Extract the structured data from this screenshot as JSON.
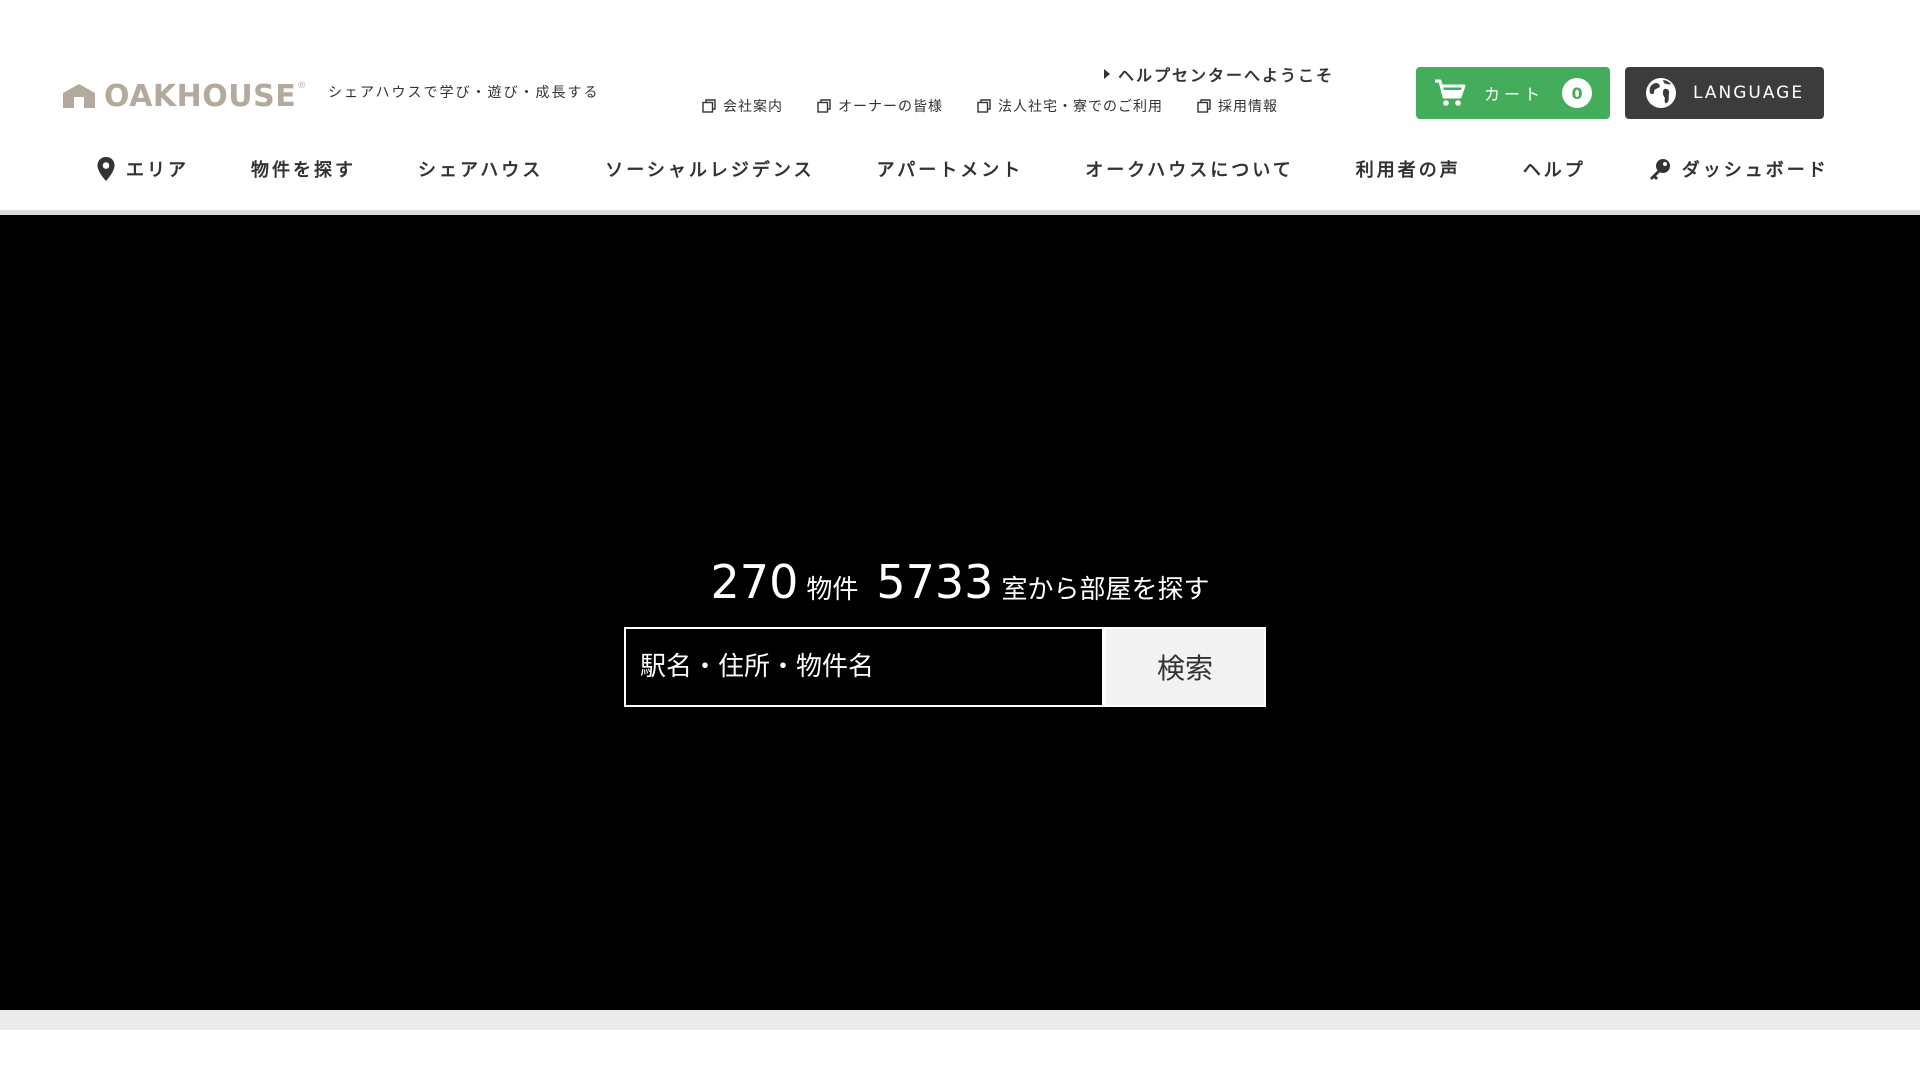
{
  "header": {
    "logo_text": "OAKHOUSE",
    "logo_mark": "®",
    "tagline": "シェアハウスで学び・遊び・成長する",
    "help_link": "ヘルプセンターへようこそ",
    "util_links": [
      {
        "label": "会社案内",
        "icon": "external-window-icon"
      },
      {
        "label": "オーナーの皆様",
        "icon": "external-window-icon"
      },
      {
        "label": "法人社宅・寮でのご利用",
        "icon": "external-window-icon"
      },
      {
        "label": "採用情報",
        "icon": "external-window-icon"
      }
    ],
    "cart": {
      "label": "カート",
      "count": "0",
      "color": "#43ad5b",
      "icon": "cart-icon"
    },
    "language": {
      "label": "LANGUAGE",
      "color": "#3c3c3c",
      "icon": "globe-icon"
    }
  },
  "nav": {
    "items": [
      {
        "label": "エリア",
        "icon": "map-pin-icon"
      },
      {
        "label": "物件を探す"
      },
      {
        "label": "シェアハウス"
      },
      {
        "label": "ソーシャルレジデンス"
      },
      {
        "label": "アパートメント"
      },
      {
        "label": "オークハウスについて"
      },
      {
        "label": "利用者の声"
      },
      {
        "label": "ヘルプ"
      },
      {
        "label": "ダッシュボード",
        "icon": "key-icon"
      }
    ]
  },
  "hero": {
    "property_count": "270",
    "property_unit": "物件",
    "room_count": "5733",
    "room_suffix": "室から部屋を探す",
    "search_placeholder": "駅名・住所・物件名",
    "search_button": "検索"
  }
}
